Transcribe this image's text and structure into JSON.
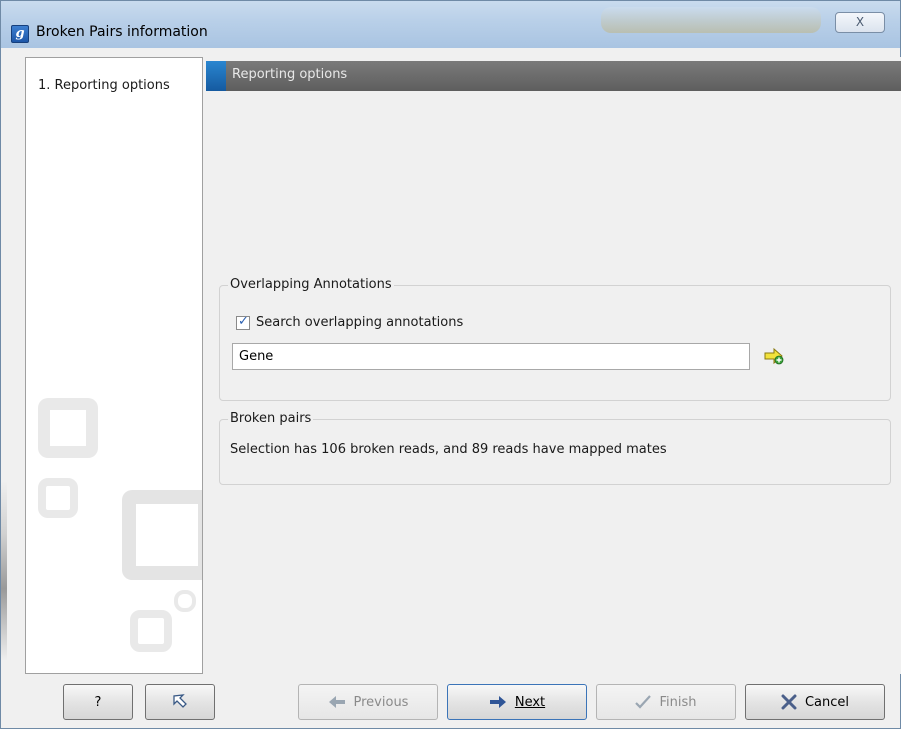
{
  "window": {
    "title": "Broken Pairs information",
    "icon_letter": "g",
    "close_label": "X"
  },
  "steps": [
    {
      "label": "1. Reporting options"
    }
  ],
  "section": {
    "title": "Reporting options"
  },
  "overlapping": {
    "group_title": "Overlapping Annotations",
    "checkbox_label": "Search overlapping annotations",
    "checked": true,
    "input_value": "Gene"
  },
  "broken_pairs": {
    "group_title": "Broken pairs",
    "text": "Selection has 106 broken reads, and 89 reads have mapped mates"
  },
  "buttons": {
    "help": "?",
    "previous": "Previous",
    "next": "Next",
    "finish": "Finish",
    "cancel": "Cancel"
  },
  "colors": {
    "accent": "#1d56a8",
    "header_bar": "#6a6a6a"
  }
}
